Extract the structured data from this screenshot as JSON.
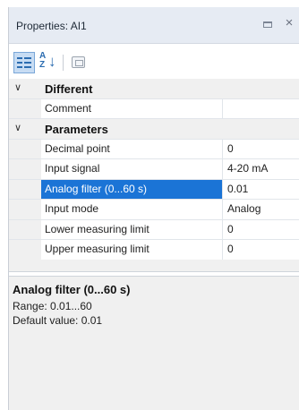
{
  "panel": {
    "title": "Properties: AI1",
    "close_glyph": "×"
  },
  "toolbar": {
    "categorized_icon": "categorized-view-icon",
    "alphabetical_icon": "sort-az-icon",
    "alphabetical_label": "A\nZ",
    "pages_icon": "property-pages-icon"
  },
  "grid": {
    "categories": [
      {
        "name": "Different",
        "expanded": true,
        "properties": [
          {
            "name": "Comment",
            "value": ""
          }
        ]
      },
      {
        "name": "Parameters",
        "expanded": true,
        "properties": [
          {
            "name": "Decimal point",
            "value": "0"
          },
          {
            "name": "Input signal",
            "value": "4-20 mA"
          },
          {
            "name": "Analog filter (0...60 s)",
            "value": "0.01",
            "selected": true
          },
          {
            "name": "Input mode",
            "value": "Analog"
          },
          {
            "name": "Lower measuring limit",
            "value": "0"
          },
          {
            "name": "Upper measuring limit",
            "value": "0"
          }
        ]
      }
    ]
  },
  "description": {
    "title": "Analog filter (0...60 s)",
    "range": "Range: 0.01...60",
    "default": "Default value: 0.01"
  },
  "colors": {
    "selection": "#1b74d6",
    "titlebar": "#e6ebf3",
    "gutter": "#f0f0f0"
  }
}
